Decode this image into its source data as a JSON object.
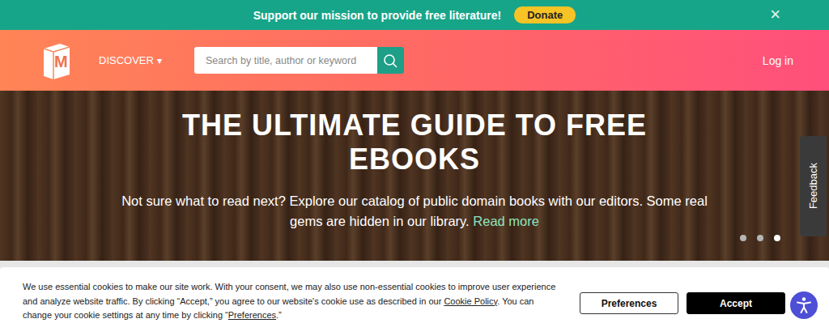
{
  "banner": {
    "message": "Support our mission to provide free literature!",
    "donate": "Donate",
    "close": "×"
  },
  "header": {
    "logo": "M",
    "discover": "DISCOVER",
    "discover_caret": "▾",
    "search": {
      "placeholder": "Search by title, author or keyword"
    },
    "login": "Log in"
  },
  "hero": {
    "title": "THE ULTIMATE GUIDE TO FREE EBOOKS",
    "subtitle": "Not sure what to read next? Explore our catalog of public domain books with our editors. Some real gems are hidden in our library.",
    "link": "Read more",
    "slides": [
      {
        "selected": false
      },
      {
        "selected": false
      },
      {
        "selected": true
      }
    ]
  },
  "feedback": "Feedback",
  "cookie": {
    "segments": [
      {
        "text": "We use essential cookies to make our site work. With your consent, we may also use non-essential cookies to improve user experience and analyze website traffic. By clicking “Accept,” you agree to our website's cookie use as described in our ",
        "link": false
      },
      {
        "text": "Cookie Policy",
        "link": true
      },
      {
        "text": ". You can change your cookie settings at any time by clicking “",
        "link": false
      },
      {
        "text": "Preferences",
        "link": true
      },
      {
        "text": ".”",
        "link": false
      }
    ],
    "buttons": [
      {
        "label": "Preferences",
        "kind": "secondary"
      },
      {
        "label": "Accept",
        "kind": "primary"
      }
    ]
  }
}
